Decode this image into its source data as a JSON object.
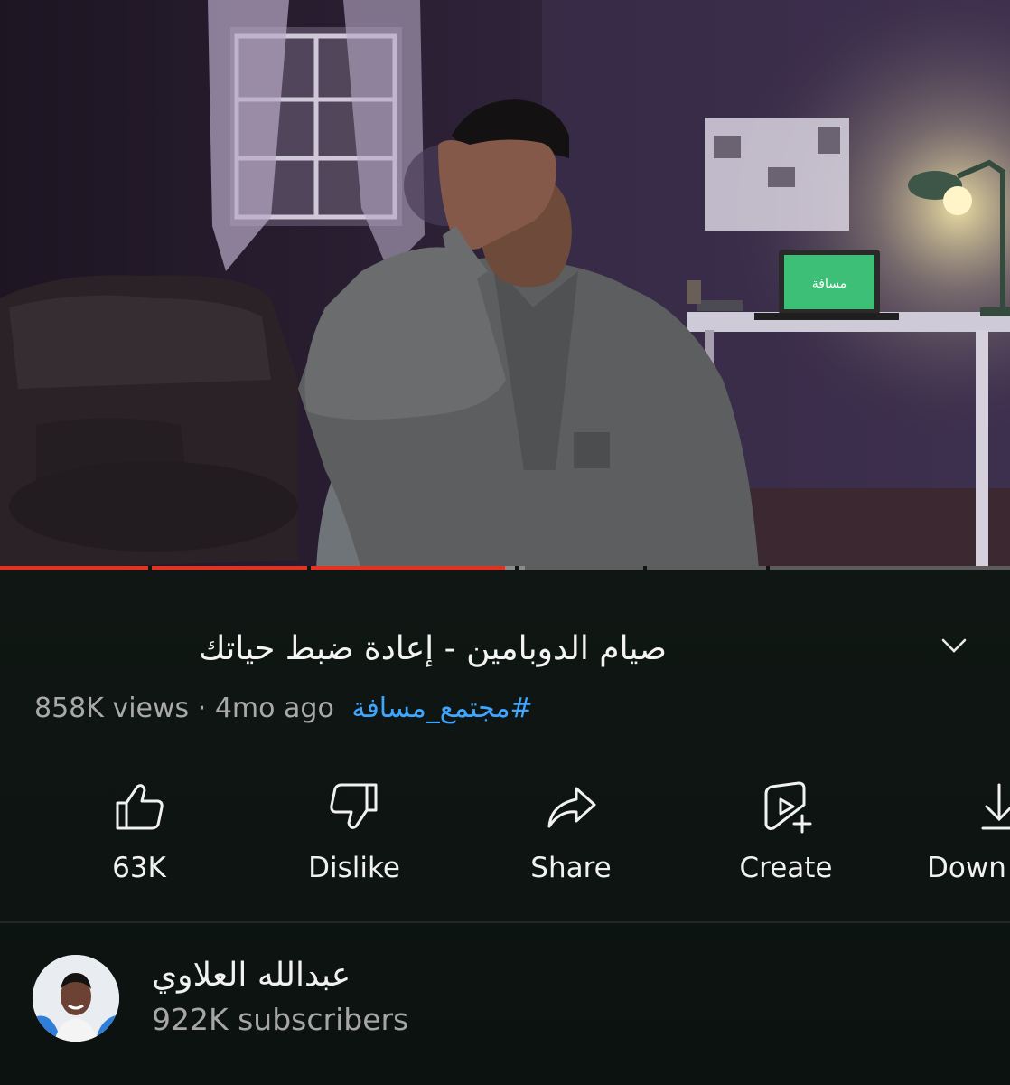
{
  "video": {
    "progress_percent": 50,
    "buffered_percent": 52
  },
  "details": {
    "title": "صيام الدوبامين - إعادة ضبط حياتك",
    "views": "858K views",
    "separator": "·",
    "age": "4mo ago",
    "hashtag": "#مجتمع_مسافة",
    "expand_icon": "chevron-down-icon"
  },
  "actions": [
    {
      "label": "63K",
      "icon": "thumbs-up-icon"
    },
    {
      "label": "Dislike",
      "icon": "thumbs-down-icon"
    },
    {
      "label": "Share",
      "icon": "share-arrow-icon"
    },
    {
      "label": "Create",
      "icon": "create-remix-icon"
    },
    {
      "label": "Down",
      "icon": "download-icon"
    }
  ],
  "channel": {
    "name": "عبدالله العلاوي",
    "subscribers": "922K subscribers"
  },
  "colors": {
    "background": "#0e1512",
    "progress": "#e5311f",
    "hashtag": "#3ea6ff",
    "secondary_text": "#a9a9a9"
  },
  "video_scene": {
    "laptop_screen_text": "مسافة"
  }
}
